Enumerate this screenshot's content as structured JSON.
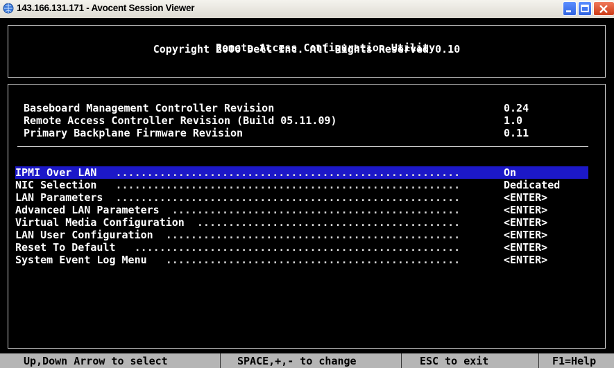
{
  "window": {
    "title": "143.166.131.171 - Avocent Session Viewer",
    "icon": "browser-globe-icon",
    "controls": [
      "minimize-icon",
      "maximize-icon",
      "close-icon"
    ]
  },
  "header": {
    "title": "Remote Access Configuration Utility",
    "copyright": "Copyright 2006 Dell Inc. All Rights Reserved 0.10"
  },
  "info": [
    {
      "label": "Baseboard Management Controller Revision",
      "value": "0.24"
    },
    {
      "label": "Remote Access Controller Revision (Build 05.11.09)",
      "value": "1.0"
    },
    {
      "label": "Primary Backplane Firmware Revision",
      "value": "0.11"
    }
  ],
  "menu": {
    "selected_index": 0,
    "items": [
      {
        "label": "IPMI Over LAN",
        "value": "On"
      },
      {
        "label": "NIC Selection",
        "value": "Dedicated"
      },
      {
        "label": "LAN Parameters",
        "value": "<ENTER>"
      },
      {
        "label": "Advanced LAN Parameters",
        "value": "<ENTER>"
      },
      {
        "label": "Virtual Media Configuration",
        "value": "<ENTER>"
      },
      {
        "label": "LAN User Configuration",
        "value": "<ENTER>"
      },
      {
        "label": "Reset To Default",
        "value": "<ENTER>"
      },
      {
        "label": "System Event Log Menu",
        "value": "<ENTER>"
      }
    ]
  },
  "status_bar": [
    "Up,Down Arrow to select",
    "SPACE,+,- to change",
    "ESC to exit",
    "F1=Help"
  ],
  "colors": {
    "background": "#000000",
    "text": "#ffffff",
    "selection": "#1c18c8",
    "status_bar": "#b5b5b5"
  }
}
